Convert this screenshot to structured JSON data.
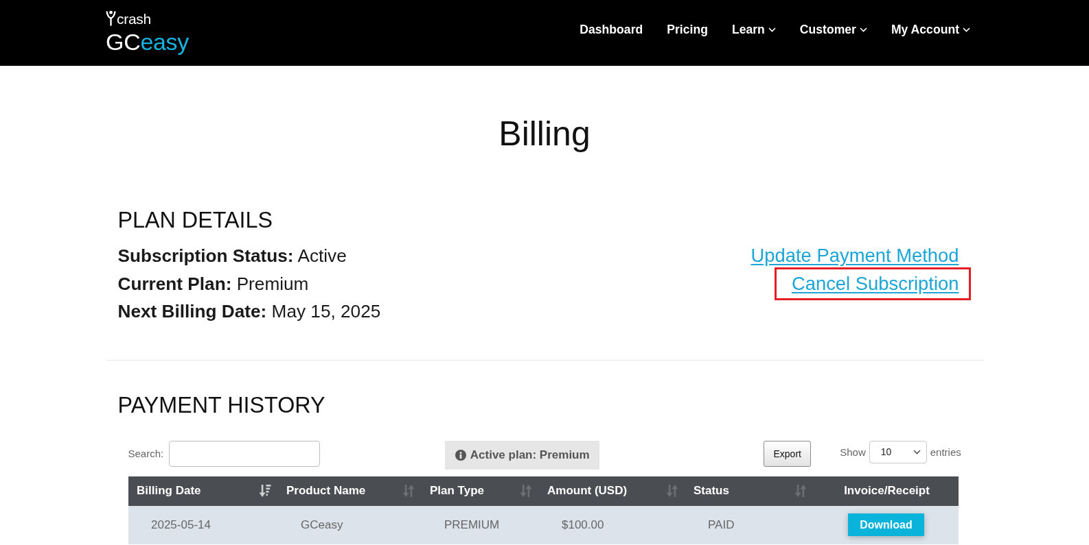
{
  "header": {
    "logo": {
      "brand": "crash",
      "wordmark": "GC",
      "wordmark_accent": "easy"
    },
    "nav": [
      {
        "label": "Dashboard",
        "has_menu": false
      },
      {
        "label": "Pricing",
        "has_menu": false
      },
      {
        "label": "Learn",
        "has_menu": true
      },
      {
        "label": "Customer",
        "has_menu": true
      },
      {
        "label": "My Account",
        "has_menu": true
      }
    ]
  },
  "page_title": "Billing",
  "plan_details": {
    "heading": "PLAN DETAILS",
    "fields": [
      {
        "label": "Subscription Status:",
        "value": "Active"
      },
      {
        "label": "Current Plan:",
        "value": "Premium"
      },
      {
        "label": "Next Billing Date:",
        "value": "May 15, 2025"
      }
    ],
    "links": [
      {
        "label": "Update Payment Method",
        "highlighted": false
      },
      {
        "label": "Cancel Subscription",
        "highlighted": true
      }
    ]
  },
  "payment_history": {
    "heading": "PAYMENT HISTORY",
    "search": {
      "label": "Search:"
    },
    "notice": "Active plan: Premium",
    "export_button": "Export",
    "page_length": {
      "label_before": "Show",
      "value": "10",
      "label_after": "entries"
    },
    "table": {
      "columns": [
        {
          "label": "Billing Date",
          "sortable": true,
          "sorted": true
        },
        {
          "label": "Product Name",
          "sortable": true,
          "sorted": false
        },
        {
          "label": "Plan Type",
          "sortable": true,
          "sorted": false
        },
        {
          "label": "Amount (USD)",
          "sortable": true,
          "sorted": false
        },
        {
          "label": "Status",
          "sortable": true,
          "sorted": false
        },
        {
          "label": "Invoice/Receipt",
          "sortable": false,
          "sorted": false
        }
      ],
      "rows": [
        {
          "cells": [
            {
              "kind": "text",
              "text": "2025-05-14"
            },
            {
              "kind": "text",
              "text": "GCeasy"
            },
            {
              "kind": "text",
              "text": "PREMIUM"
            },
            {
              "kind": "text",
              "text": "$100.00"
            },
            {
              "kind": "text",
              "text": "PAID"
            },
            {
              "kind": "button",
              "text": "Download"
            }
          ]
        }
      ]
    }
  }
}
